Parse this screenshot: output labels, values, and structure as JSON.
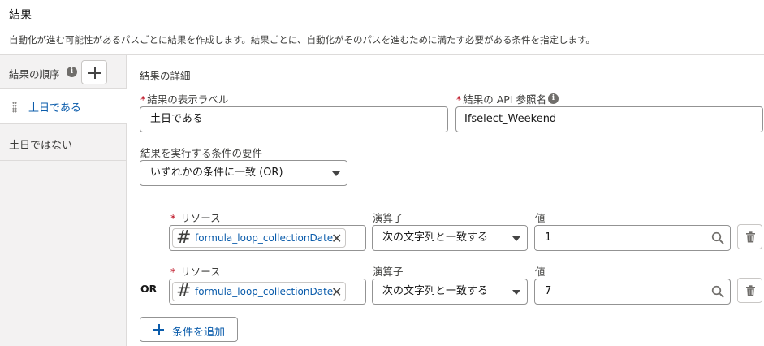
{
  "header": {
    "title": "結果",
    "description": "自動化が進む可能性があるパスごとに結果を作成します。結果ごとに、自動化がそのパスを進むために満たす必要がある条件を指定します。"
  },
  "sidebar": {
    "heading": "結果の順序",
    "items": [
      {
        "label": "土日である",
        "active": true
      },
      {
        "label": "土日ではない",
        "active": false
      }
    ]
  },
  "details": {
    "section_title": "結果の詳細",
    "label_field": {
      "label": "結果の表示ラベル",
      "value": "土日である",
      "required": true
    },
    "api_field": {
      "label": "結果の API 参照名",
      "value": "Ifselect_Weekend",
      "required": true
    },
    "requirement": {
      "label": "結果を実行する条件の要件",
      "value": "いずれかの条件に一致 (OR)"
    }
  },
  "conditions": {
    "resource_label": "リソース",
    "operator_label": "演算子",
    "value_label": "値",
    "rows": [
      {
        "prefix": "",
        "resource": "formula_loop_collectionDate",
        "operator": "次の文字列と一致する",
        "value": "1"
      },
      {
        "prefix": "OR",
        "resource": "formula_loop_collectionDate",
        "operator": "次の文字列と一致する",
        "value": "7"
      }
    ],
    "add_button": "条件を追加"
  },
  "colors": {
    "accent": "#0b5cab",
    "required": "#ba0517",
    "sidebar_bg": "#f3f2f2"
  }
}
